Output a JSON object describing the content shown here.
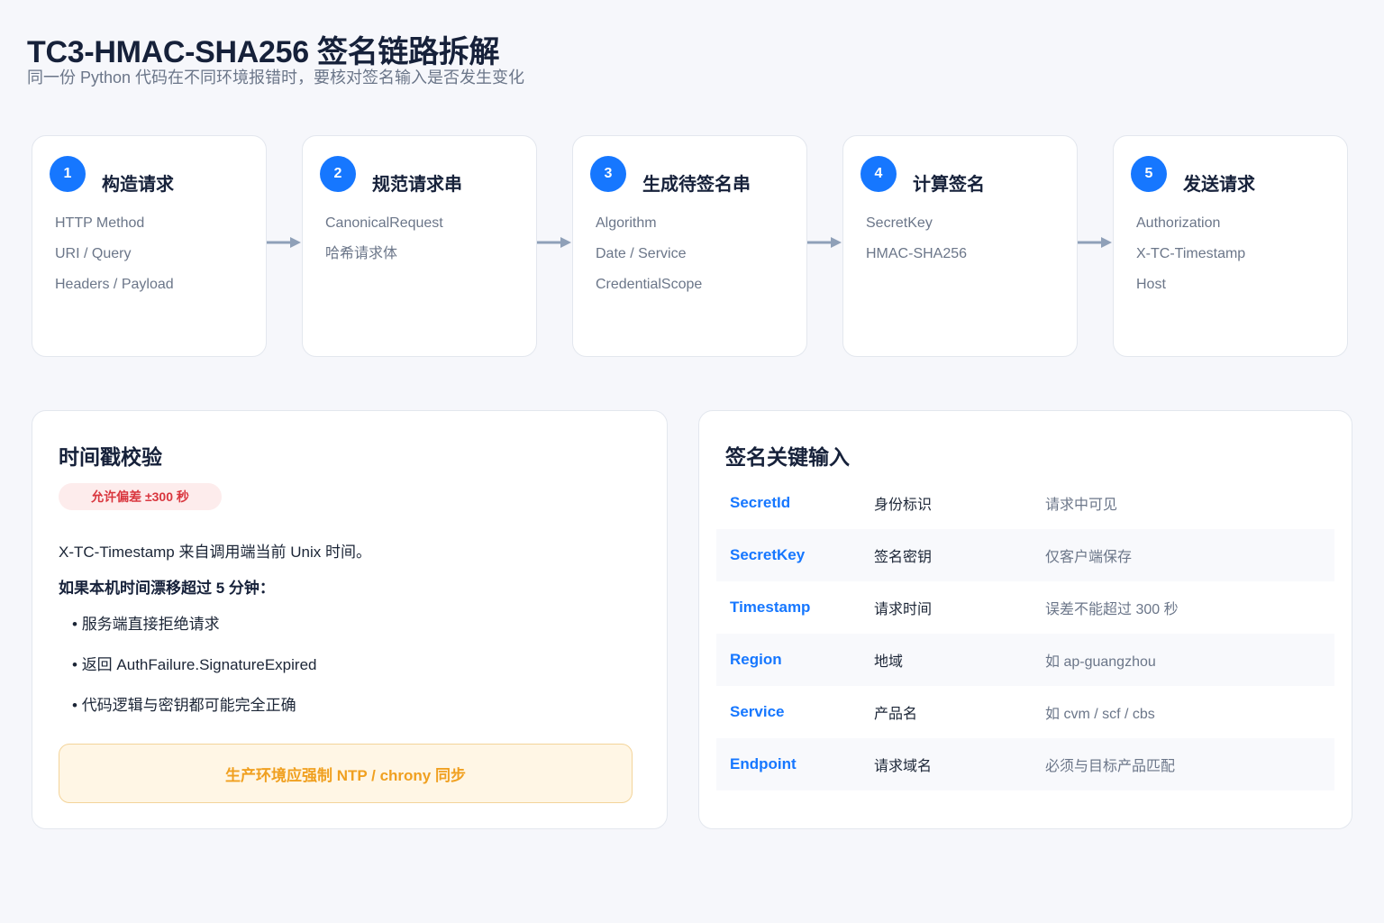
{
  "header": {
    "title": "TC3-HMAC-SHA256 签名链路拆解",
    "subtitle": "同一份 Python 代码在不同环境报错时，要核对签名输入是否发生变化"
  },
  "steps": [
    {
      "num": "1",
      "title": "构造请求",
      "items": [
        "HTTP Method",
        "URI / Query",
        "Headers / Payload"
      ]
    },
    {
      "num": "2",
      "title": "规范请求串",
      "items": [
        "CanonicalRequest",
        "哈希请求体"
      ]
    },
    {
      "num": "3",
      "title": "生成待签名串",
      "items": [
        "Algorithm",
        "Date / Service",
        "CredentialScope"
      ]
    },
    {
      "num": "4",
      "title": "计算签名",
      "items": [
        "SecretKey",
        "HMAC-SHA256"
      ]
    },
    {
      "num": "5",
      "title": "发送请求",
      "items": [
        "Authorization",
        "X-TC-Timestamp",
        "Host"
      ]
    }
  ],
  "timestamp_panel": {
    "title": "时间戳校验",
    "badge": "允许偏差 ±300 秒",
    "description": "X-TC-Timestamp 来自调用端当前 Unix 时间。",
    "warning_title": "如果本机时间漂移超过 5 分钟：",
    "bullets": [
      "服务端直接拒绝请求",
      "返回 AuthFailure.SignatureExpired",
      "代码逻辑与密钥都可能完全正确"
    ],
    "callout": "生产环境应强制 NTP / chrony 同步"
  },
  "inputs_panel": {
    "title": "签名关键输入",
    "rows": [
      {
        "name": "SecretId",
        "desc": "身份标识",
        "note": "请求中可见"
      },
      {
        "name": "SecretKey",
        "desc": "签名密钥",
        "note": "仅客户端保存"
      },
      {
        "name": "Timestamp",
        "desc": "请求时间",
        "note": "误差不能超过 300 秒"
      },
      {
        "name": "Region",
        "desc": "地域",
        "note": "如 ap-guangzhou"
      },
      {
        "name": "Service",
        "desc": "产品名",
        "note": "如 cvm / scf / cbs"
      },
      {
        "name": "Endpoint",
        "desc": "请求域名",
        "note": "必须与目标产品匹配"
      }
    ]
  },
  "colors": {
    "accent": "#1677ff",
    "arrow": "#8fa0b8",
    "badge_text": "#d9363e",
    "callout_text": "#f0a020"
  }
}
